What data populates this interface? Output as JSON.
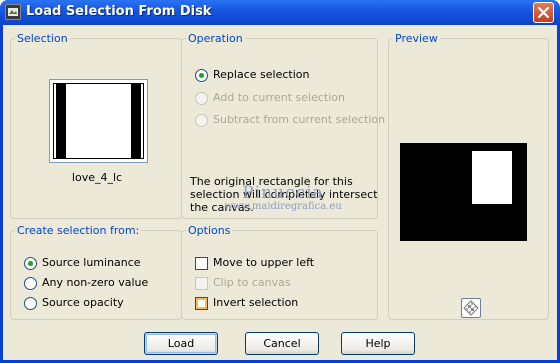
{
  "window": {
    "title": "Load Selection From Disk"
  },
  "icons": {
    "app": "app-icon",
    "close": "close-icon",
    "proof": "checkerboard-icon"
  },
  "selection_group": {
    "legend": "Selection",
    "thumbnail_name": "love_4_lc"
  },
  "operation_group": {
    "legend": "Operation",
    "options": [
      {
        "label": "Replace selection",
        "selected": true,
        "enabled": true
      },
      {
        "label": "Add to current selection",
        "selected": false,
        "enabled": false
      },
      {
        "label": "Subtract from current selection",
        "selected": false,
        "enabled": false
      }
    ],
    "info": "The original rectangle for this selection will completely intersect the canvas."
  },
  "watermark": {
    "line1": "Pinuccia",
    "line2": "www.maidiregrafica.eu"
  },
  "preview_group": {
    "legend": "Preview"
  },
  "create_group": {
    "legend": "Create selection from:",
    "options": [
      {
        "label": "Source luminance",
        "selected": true
      },
      {
        "label": "Any non-zero value",
        "selected": false
      },
      {
        "label": "Source opacity",
        "selected": false
      }
    ]
  },
  "options_group": {
    "legend": "Options",
    "checks": [
      {
        "label": "Move to upper left",
        "checked": false,
        "enabled": true
      },
      {
        "label": "Clip to canvas",
        "checked": false,
        "enabled": false
      },
      {
        "label": "Invert selection",
        "checked": false,
        "enabled": true
      }
    ]
  },
  "buttons": {
    "load": "Load",
    "cancel": "Cancel",
    "help": "Help"
  },
  "colors": {
    "titlebar": "#0c44c8",
    "dialog_bg": "#ece9d8",
    "legend_text": "#0046d5",
    "radio_dot": "#21a121"
  }
}
